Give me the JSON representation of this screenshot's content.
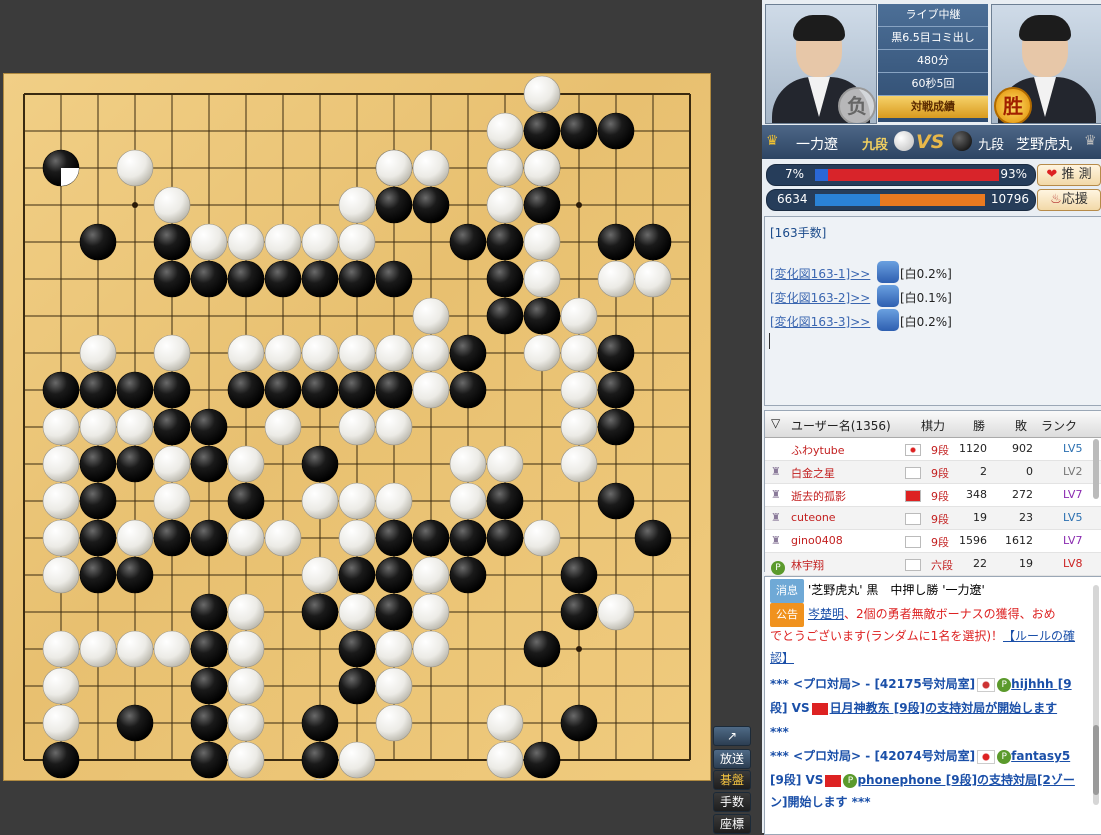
{
  "board": {
    "size": 19,
    "hoshi": [
      [
        3,
        3
      ],
      [
        3,
        9
      ],
      [
        3,
        15
      ],
      [
        9,
        3
      ],
      [
        9,
        9
      ],
      [
        9,
        15
      ],
      [
        15,
        3
      ],
      [
        15,
        9
      ],
      [
        15,
        15
      ]
    ],
    "black": [
      [
        14,
        1
      ],
      [
        15,
        1
      ],
      [
        16,
        1
      ],
      [
        10,
        2
      ],
      [
        14,
        2
      ],
      [
        10,
        3
      ],
      [
        11,
        3
      ],
      [
        14,
        3
      ],
      [
        2,
        4
      ],
      [
        4,
        4
      ],
      [
        12,
        4
      ],
      [
        13,
        4
      ],
      [
        16,
        4
      ],
      [
        17,
        4
      ],
      [
        4,
        5
      ],
      [
        5,
        5
      ],
      [
        6,
        5
      ],
      [
        7,
        5
      ],
      [
        8,
        5
      ],
      [
        9,
        5
      ],
      [
        10,
        5
      ],
      [
        13,
        5
      ],
      [
        13,
        6
      ],
      [
        14,
        6
      ],
      [
        12,
        7
      ],
      [
        16,
        7
      ],
      [
        1,
        8
      ],
      [
        2,
        8
      ],
      [
        3,
        8
      ],
      [
        4,
        8
      ],
      [
        6,
        8
      ],
      [
        7,
        8
      ],
      [
        8,
        8
      ],
      [
        9,
        8
      ],
      [
        10,
        8
      ],
      [
        12,
        8
      ],
      [
        16,
        8
      ],
      [
        4,
        9
      ],
      [
        5,
        9
      ],
      [
        16,
        9
      ],
      [
        2,
        10
      ],
      [
        3,
        10
      ],
      [
        5,
        10
      ],
      [
        8,
        10
      ],
      [
        2,
        11
      ],
      [
        6,
        11
      ],
      [
        13,
        11
      ],
      [
        16,
        11
      ],
      [
        2,
        12
      ],
      [
        4,
        12
      ],
      [
        5,
        12
      ],
      [
        10,
        12
      ],
      [
        11,
        12
      ],
      [
        12,
        12
      ],
      [
        13,
        12
      ],
      [
        17,
        12
      ],
      [
        2,
        13
      ],
      [
        3,
        13
      ],
      [
        9,
        13
      ],
      [
        10,
        13
      ],
      [
        12,
        13
      ],
      [
        15,
        13
      ],
      [
        5,
        14
      ],
      [
        8,
        14
      ],
      [
        10,
        14
      ],
      [
        15,
        14
      ],
      [
        5,
        15
      ],
      [
        9,
        15
      ],
      [
        14,
        15
      ],
      [
        5,
        16
      ],
      [
        9,
        16
      ],
      [
        3,
        17
      ],
      [
        5,
        17
      ],
      [
        8,
        17
      ],
      [
        15,
        17
      ],
      [
        1,
        18
      ],
      [
        5,
        18
      ],
      [
        8,
        18
      ],
      [
        14,
        18
      ]
    ],
    "white": [
      [
        14,
        0
      ],
      [
        13,
        1
      ],
      [
        3,
        2
      ],
      [
        10,
        2
      ],
      [
        11,
        2
      ],
      [
        13,
        2
      ],
      [
        14,
        2
      ],
      [
        4,
        3
      ],
      [
        9,
        3
      ],
      [
        13,
        3
      ],
      [
        5,
        4
      ],
      [
        6,
        4
      ],
      [
        7,
        4
      ],
      [
        8,
        4
      ],
      [
        9,
        4
      ],
      [
        14,
        4
      ],
      [
        14,
        5
      ],
      [
        16,
        5
      ],
      [
        17,
        5
      ],
      [
        11,
        6
      ],
      [
        15,
        6
      ],
      [
        2,
        7
      ],
      [
        4,
        7
      ],
      [
        6,
        7
      ],
      [
        7,
        7
      ],
      [
        8,
        7
      ],
      [
        9,
        7
      ],
      [
        10,
        7
      ],
      [
        11,
        7
      ],
      [
        14,
        7
      ],
      [
        15,
        7
      ],
      [
        11,
        8
      ],
      [
        15,
        8
      ],
      [
        1,
        9
      ],
      [
        2,
        9
      ],
      [
        3,
        9
      ],
      [
        7,
        9
      ],
      [
        9,
        9
      ],
      [
        10,
        9
      ],
      [
        15,
        9
      ],
      [
        1,
        10
      ],
      [
        4,
        10
      ],
      [
        6,
        10
      ],
      [
        12,
        10
      ],
      [
        13,
        10
      ],
      [
        15,
        10
      ],
      [
        1,
        11
      ],
      [
        4,
        11
      ],
      [
        8,
        11
      ],
      [
        9,
        11
      ],
      [
        10,
        11
      ],
      [
        12,
        11
      ],
      [
        1,
        12
      ],
      [
        3,
        12
      ],
      [
        6,
        12
      ],
      [
        7,
        12
      ],
      [
        9,
        12
      ],
      [
        14,
        12
      ],
      [
        1,
        13
      ],
      [
        8,
        13
      ],
      [
        11,
        13
      ],
      [
        6,
        14
      ],
      [
        9,
        14
      ],
      [
        11,
        14
      ],
      [
        16,
        14
      ],
      [
        1,
        15
      ],
      [
        2,
        15
      ],
      [
        3,
        15
      ],
      [
        4,
        15
      ],
      [
        6,
        15
      ],
      [
        10,
        15
      ],
      [
        11,
        15
      ],
      [
        1,
        16
      ],
      [
        6,
        16
      ],
      [
        10,
        16
      ],
      [
        1,
        17
      ],
      [
        6,
        17
      ],
      [
        10,
        17
      ],
      [
        13,
        17
      ],
      [
        6,
        18
      ],
      [
        9,
        18
      ],
      [
        13,
        18
      ],
      [
        8,
        19
      ]
    ],
    "marker": [
      1,
      2
    ]
  },
  "side_buttons": [
    "放送",
    "碁盤",
    "手数",
    "座標"
  ],
  "players": {
    "white": {
      "name": "一力遼",
      "rank": "九段",
      "badge": "负"
    },
    "black": {
      "name": "芝野虎丸",
      "rank": "九段",
      "badge": "胜"
    },
    "vs": "VS"
  },
  "game_info": [
    "ライブ中継",
    "黒6.5目コミ出し",
    "480分",
    "60秒5回",
    "対戦成績"
  ],
  "win_bar": {
    "left": "7%",
    "right": "93%",
    "left_fraction": 0.07,
    "btn": "推 測"
  },
  "support_bar": {
    "left": "6634",
    "right": "10796",
    "left_fraction": 0.38,
    "btn": "応援"
  },
  "comment": {
    "move": "[163手数]",
    "links": [
      {
        "label": "[変化図163-1]>>",
        "eval": "[白0.2%]"
      },
      {
        "label": "[変化図163-2]>>",
        "eval": "[白0.1%]"
      },
      {
        "label": "[変化図163-3]>>",
        "eval": "[白0.2%]"
      }
    ]
  },
  "users": {
    "headers": {
      "name": "ユーザー名(1356)",
      "rank": "棋力",
      "win": "勝",
      "loss": "敗",
      "level": "ランク"
    },
    "rows": [
      {
        "name": "ふわytube",
        "rank": "9段",
        "win": "1120",
        "loss": "902",
        "level": "LV5",
        "level_color": "#2a6fb0"
      },
      {
        "name": "白金之星",
        "rank": "9段",
        "win": "2",
        "loss": "0",
        "level": "LV2",
        "level_color": "#777777"
      },
      {
        "name": "逝去的孤影",
        "rank": "9段",
        "win": "348",
        "loss": "272",
        "level": "LV7",
        "level_color": "#8a2ab0"
      },
      {
        "name": "cuteone",
        "rank": "9段",
        "win": "19",
        "loss": "23",
        "level": "LV5",
        "level_color": "#2a6fb0"
      },
      {
        "name": "gino0408",
        "rank": "9段",
        "win": "1596",
        "loss": "1612",
        "level": "LV7",
        "level_color": "#8a2ab0"
      },
      {
        "name": "林宇翔",
        "rank": "六段",
        "win": "22",
        "loss": "19",
        "level": "LV8",
        "level_color": "#cc2222"
      }
    ]
  },
  "chat": {
    "tag1": "消息",
    "line1": "'芝野虎丸' 黒　中押し勝 '一力遼'",
    "tag2": "公告",
    "line2_name": "岑楚明",
    "line2a": "、2個の勇者無敵ボーナスの獲得、おめ",
    "line2b": "でとうございます(ランダムに1名を選択)！",
    "line2_link": "【ルールの確認】",
    "line3a": "*** <プロ対局> - [42175号対局室]",
    "line3b": "hijhhh [9",
    "line3c": "段] VS",
    "line3d": "日月神教东 [9段]の支持対局が開始します",
    "line3e": "***",
    "line4a": "*** <プロ対局> - [42074号対局室]",
    "line4b": "fantasy5",
    "line4c": "[9段] VS",
    "line4d": "phonephone [9段]の支持対局[2ゾー",
    "line4e": "ン]開始します ***"
  }
}
